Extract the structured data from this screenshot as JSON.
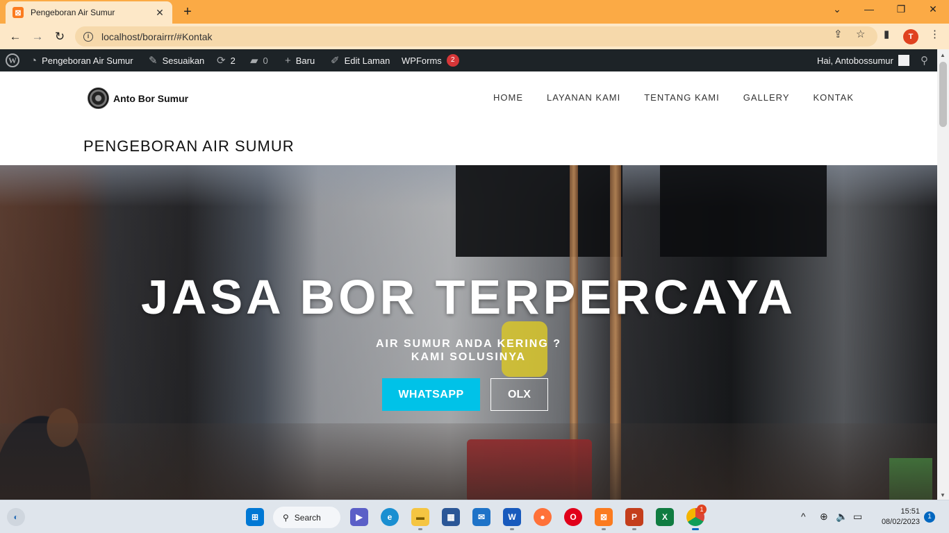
{
  "browser": {
    "tab_title": "Pengeboran Air Sumur",
    "tab_favicon": "xampp-icon",
    "url": "localhost/borairrr/#Kontak",
    "profile_initial": "T",
    "theme_color": "#fbaa45"
  },
  "adminbar": {
    "site_name": "Pengeboran Air Sumur",
    "customize": "Sesuaikan",
    "updates_count": "2",
    "comments_count": "0",
    "new_label": "Baru",
    "edit_page": "Edit Laman",
    "wpforms": "WPForms",
    "wpforms_badge": "2",
    "greeting": "Hai, Antobossumur"
  },
  "site": {
    "brand_name": "Anto Bor Sumur",
    "menu": [
      "HOME",
      "LAYANAN KAMI",
      "TENTANG KAMI",
      "GALLERY",
      "KONTAK"
    ],
    "page_heading": "PENGEBORAN AIR SUMUR"
  },
  "hero": {
    "title": "JASA BOR TERPERCAYA",
    "subtitle_line1": "AIR SUMUR ANDA KERING ?",
    "subtitle_line2": "KAMI SOLUSINYA",
    "btn_primary": "WHATSAPP",
    "btn_secondary": "OLX",
    "accent_color": "#00c2e8"
  },
  "taskbar": {
    "search_label": "Search",
    "time": "15:51",
    "date": "08/02/2023",
    "notification_count": "1",
    "chrome_badge": "1"
  }
}
